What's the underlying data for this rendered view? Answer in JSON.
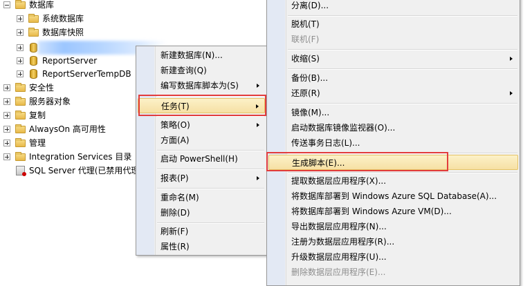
{
  "tree": {
    "databases": "数据库",
    "system_databases": "系统数据库",
    "database_snapshots": "数据库快照",
    "reportserver": "ReportServer",
    "reportserver_temp": "ReportServerTempDB",
    "security": "安全性",
    "server_objects": "服务器对象",
    "replication": "复制",
    "alwayson": "AlwaysOn 高可用性",
    "management": "管理",
    "integration_services": "Integration Services 目录",
    "sql_agent": "SQL Server 代理(已禁用代理"
  },
  "context_menu": {
    "new_database": "新建数据库(N)...",
    "new_query": "新建查询(Q)",
    "script_database_as": "编写数据库脚本为(S)",
    "tasks": "任务(T)",
    "policies": "策略(O)",
    "facets": "方面(A)",
    "start_powershell": "启动 PowerShell(H)",
    "reports": "报表(P)",
    "rename": "重命名(M)",
    "delete": "删除(D)",
    "refresh": "刷新(F)",
    "properties": "属性(R)"
  },
  "tasks_menu": {
    "detach": "分离(D)...",
    "take_offline": "脱机(T)",
    "bring_online": "联机(F)",
    "shrink": "收缩(S)",
    "backup": "备份(B)...",
    "restore": "还原(R)",
    "mirror": "镜像(M)...",
    "launch_mirroring_monitor": "启动数据库镜像监视器(O)...",
    "ship_transaction_logs": "传送事务日志(L)...",
    "generate_scripts": "生成脚本(E)...",
    "extract_data_tier_app": "提取数据层应用程序(X)...",
    "deploy_azure_sql": "将数据库部署到 Windows Azure SQL Database(A)...",
    "deploy_azure_vm": "将数据库部署到 Windows Azure VM(D)...",
    "export_data_tier_app": "导出数据层应用程序(N)...",
    "register_data_tier_app": "注册为数据层应用程序(R)...",
    "upgrade_data_tier_app": "升级数据层应用程序(U)...",
    "delete_data_tier_app": "删除数据层应用程序(E)..."
  },
  "colors": {
    "callout": "#e23c3c",
    "highlight": "#f6e0a4",
    "menu_bg": "#f0f0f0"
  }
}
